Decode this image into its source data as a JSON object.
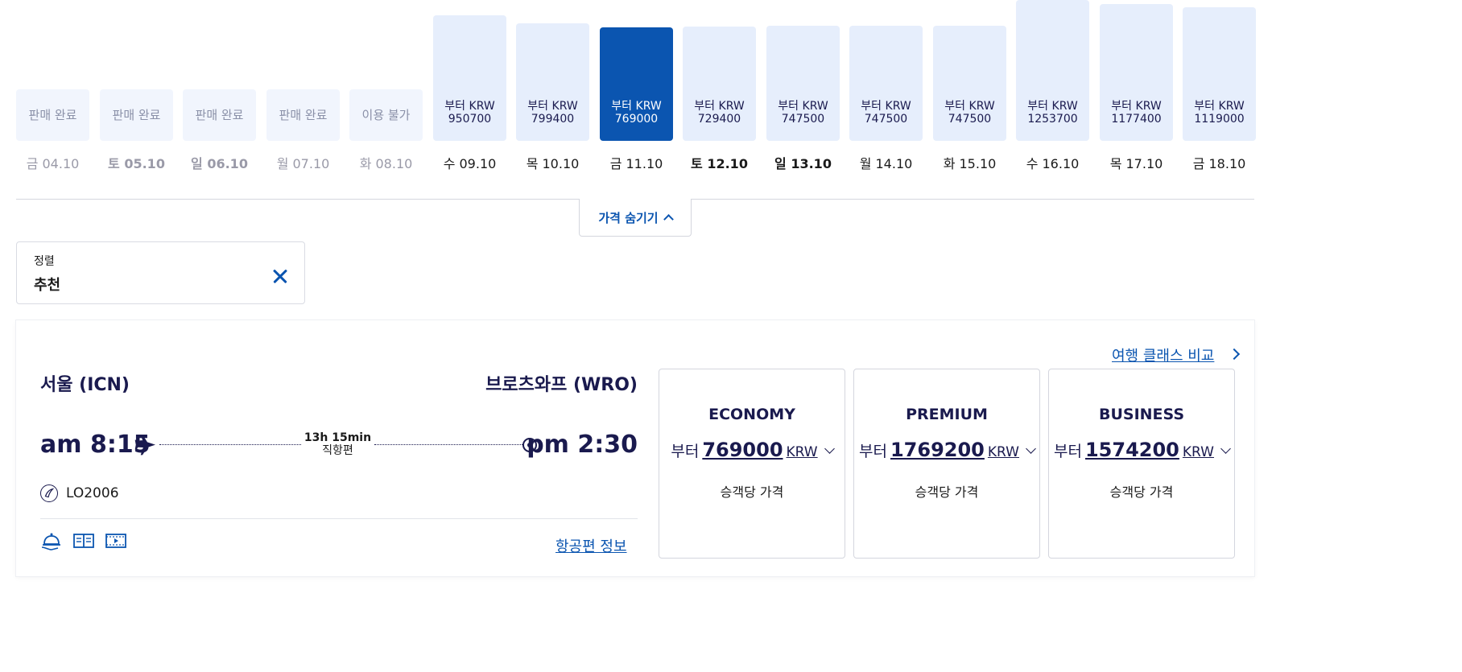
{
  "dates": [
    {
      "price_text": "판매 완료",
      "label": "금 04.10",
      "status": "soldout",
      "bold": false
    },
    {
      "price_text": "판매 완료",
      "label": "토 05.10",
      "status": "soldout",
      "bold": true
    },
    {
      "price_text": "판매 완료",
      "label": "일 06.10",
      "status": "soldout",
      "bold": true
    },
    {
      "price_text": "판매 완료",
      "label": "월 07.10",
      "status": "soldout",
      "bold": false
    },
    {
      "price_text": "이용 불가",
      "label": "화 08.10",
      "status": "unavailable",
      "bold": false
    },
    {
      "price_text": "부터 KRW 950700",
      "label": "수 09.10",
      "status": "available",
      "bold": false,
      "price": 950700
    },
    {
      "price_text": "부터 KRW 799400",
      "label": "목 10.10",
      "status": "available",
      "bold": false,
      "price": 799400
    },
    {
      "price_text": "부터 KRW 769000",
      "label": "금 11.10",
      "status": "selected",
      "bold": false,
      "price": 769000
    },
    {
      "price_text": "부터 KRW 729400",
      "label": "토 12.10",
      "status": "available",
      "bold": true,
      "price": 729400
    },
    {
      "price_text": "부터 KRW 747500",
      "label": "일 13.10",
      "status": "available",
      "bold": true,
      "price": 747500
    },
    {
      "price_text": "부터 KRW 747500",
      "label": "월 14.10",
      "status": "available",
      "bold": false,
      "price": 747500
    },
    {
      "price_text": "부터 KRW 747500",
      "label": "화 15.10",
      "status": "available",
      "bold": false,
      "price": 747500
    },
    {
      "price_text": "부터 KRW 1253700",
      "label": "수 16.10",
      "status": "available",
      "bold": false,
      "price": 1253700
    },
    {
      "price_text": "부터 KRW 1177400",
      "label": "목 17.10",
      "status": "available",
      "bold": false,
      "price": 1177400
    },
    {
      "price_text": "부터 KRW 1119000",
      "label": "금 18.10",
      "status": "available",
      "bold": false,
      "price": 1119000
    }
  ],
  "hide_prices_label": "가격 숨기기",
  "sort": {
    "label": "정렬",
    "value": "추천"
  },
  "flight": {
    "origin": "서울 (ICN)",
    "destination": "브로츠와프 (WRO)",
    "departure_time": "am 8:15",
    "arrival_time": "pm 2:30",
    "duration": "13h 15min",
    "stops": "직항편",
    "flight_number": "LO2006",
    "flight_info_link": "항공편 정보",
    "compare_link": "여행 클래스 비교"
  },
  "fare_classes": [
    {
      "name": "ECONOMY",
      "from": "부터",
      "price": "769000",
      "currency": "KRW",
      "per_passenger": "승객당 가격"
    },
    {
      "name": "PREMIUM",
      "from": "부터",
      "price": "1769200",
      "currency": "KRW",
      "per_passenger": "승객당 가격"
    },
    {
      "name": "BUSINESS",
      "from": "부터",
      "price": "1574200",
      "currency": "KRW",
      "per_passenger": "승객당 가격"
    }
  ],
  "colors": {
    "brand": "#0b55b0",
    "text_dark": "#1a1a4e",
    "bar_light": "#e6eefc"
  },
  "icons": [
    "airplane-icon",
    "destination-dot-icon",
    "airline-logo-icon",
    "meal-service-icon",
    "entertainment-book-icon",
    "entertainment-video-icon",
    "close-icon",
    "chevron-up-icon",
    "chevron-down-icon",
    "chevron-right-icon"
  ]
}
